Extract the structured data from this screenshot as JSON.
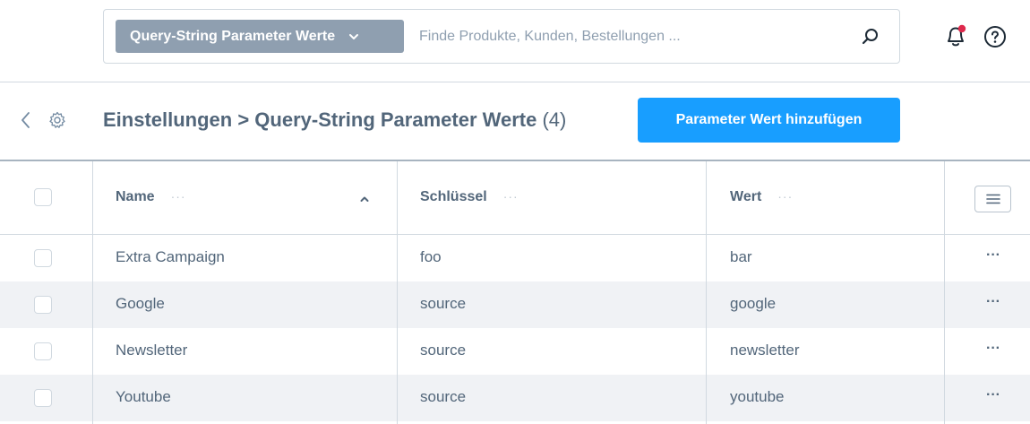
{
  "search": {
    "type_label": "Query-String Parameter Werte",
    "placeholder": "Finde Produkte, Kunden, Bestellungen ..."
  },
  "header": {
    "title": "Einstellungen > Query-String Parameter Werte",
    "count": "(4)",
    "add_button": "Parameter Wert hinzufügen"
  },
  "table": {
    "columns": [
      "Name",
      "Schlüssel",
      "Wert"
    ],
    "column_menu": "···",
    "row_menu": "···",
    "rows": [
      {
        "name": "Extra Campaign",
        "key": "foo",
        "value": "bar"
      },
      {
        "name": "Google",
        "key": "source",
        "value": "google"
      },
      {
        "name": "Newsletter",
        "key": "source",
        "value": "newsletter"
      },
      {
        "name": "Youtube",
        "key": "source",
        "value": "youtube"
      }
    ]
  },
  "colors": {
    "primary": "#189eff",
    "notification_dot": "#de294c",
    "text": "#52667a",
    "select_bg": "#8f9fb0"
  },
  "icons": [
    "chevron-down-icon",
    "search-icon",
    "bell-icon",
    "help-icon",
    "back-icon",
    "gear-icon",
    "sort-asc-icon",
    "list-settings-icon"
  ]
}
